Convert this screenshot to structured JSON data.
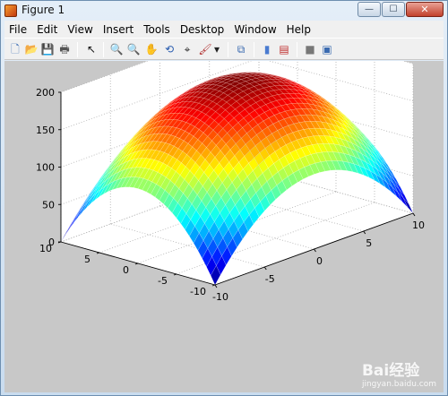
{
  "window": {
    "title": "Figure 1"
  },
  "window_controls": {
    "minimize": "—",
    "maximize": "☐",
    "close": "✕"
  },
  "menu": [
    "File",
    "Edit",
    "View",
    "Insert",
    "Tools",
    "Desktop",
    "Window",
    "Help"
  ],
  "toolbar": [
    {
      "name": "new-figure-icon",
      "glyph": "🗋",
      "color": "#3c6db4"
    },
    {
      "name": "open-file-icon",
      "glyph": "📂",
      "color": "#d8a520"
    },
    {
      "name": "save-icon",
      "glyph": "💾",
      "color": "#2a4f9a"
    },
    {
      "name": "print-icon",
      "glyph": "🖶",
      "color": "#555555"
    },
    {
      "name": "edit-plot-arrow-icon",
      "glyph": "↖",
      "color": "#111111"
    },
    {
      "name": "zoom-in-icon",
      "glyph": "🔍",
      "color": "#2a5db0"
    },
    {
      "name": "zoom-out-icon",
      "glyph": "🔍",
      "color": "#2a5db0"
    },
    {
      "name": "pan-hand-icon",
      "glyph": "✋",
      "color": "#8a6a3a"
    },
    {
      "name": "rotate-3d-icon",
      "glyph": "⟲",
      "color": "#2a5db0"
    },
    {
      "name": "data-cursor-icon",
      "glyph": "⌖",
      "color": "#2a2a2a"
    },
    {
      "name": "brush-icon",
      "glyph": "🖌",
      "color": "#b03030"
    },
    {
      "name": "brush-dropdown-icon",
      "glyph": "▾",
      "color": "#222222"
    },
    {
      "name": "link-plot-icon",
      "glyph": "⧉",
      "color": "#3a6ab0"
    },
    {
      "name": "colorbar-icon",
      "glyph": "▮",
      "color": "#4a7bd0"
    },
    {
      "name": "legend-icon",
      "glyph": "▤",
      "color": "#c03030"
    },
    {
      "name": "hide-plot-tools-icon",
      "glyph": "■",
      "color": "#777777"
    },
    {
      "name": "show-plot-tools-icon",
      "glyph": "▣",
      "color": "#3a6ab0"
    }
  ],
  "watermark": {
    "text": "Bai经验",
    "sub": "jingyan.baidu.com"
  },
  "chart_data": {
    "type": "surface",
    "function": "z = 200 - x^2 - y^2",
    "x_range": [
      -10,
      10
    ],
    "y_range": [
      -10,
      10
    ],
    "z_range": [
      0,
      200
    ],
    "colormap": "jet",
    "grid": true,
    "x_ticks": [
      "-10",
      "-5",
      "0",
      "5",
      "10"
    ],
    "y_ticks": [
      "-10",
      "-5",
      "0",
      "5",
      "10"
    ],
    "z_ticks": [
      "0",
      "50",
      "100",
      "150",
      "200"
    ]
  }
}
